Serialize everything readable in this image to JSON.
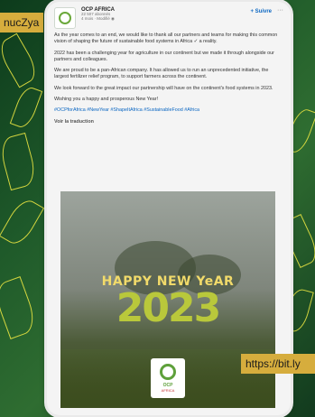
{
  "overlays": {
    "left_tag": "nucZya",
    "right_tag": "https://bit.ly"
  },
  "post": {
    "company": "OCP AFRICA",
    "followers": "22 507 abonnés",
    "time": "4 mois · Modifié",
    "follow_label": "+ Suivre",
    "more_label": "···",
    "paragraphs": [
      "As the year comes to an end, we would like to thank all our partners and teams for making this common vision of shaping the future of sustainable food systems in Africa ✓ a reality.",
      "2022 has been a challenging year for agriculture in our continent but we made it through alongside our partners and colleagues.",
      "We are proud to be a pan-African company. It has allowed us to run an unprecedented initiative, the largest fertilizer relief program, to support farmers across the continent.",
      "We look forward to the great impact our partnership will have on the continent's food systems in 2023.",
      "Wishing you a happy and prosperous New Year!"
    ],
    "hashtags": "#OCPforAfrica #NewYear #ShapeItAfrica #SustainableFood #Africa",
    "see_translation": "Voir la traduction"
  },
  "image": {
    "banner": "HAPPY NEW YeAR",
    "year": "2023",
    "logo_label": "OCP",
    "logo_sub": "AFRICA"
  }
}
